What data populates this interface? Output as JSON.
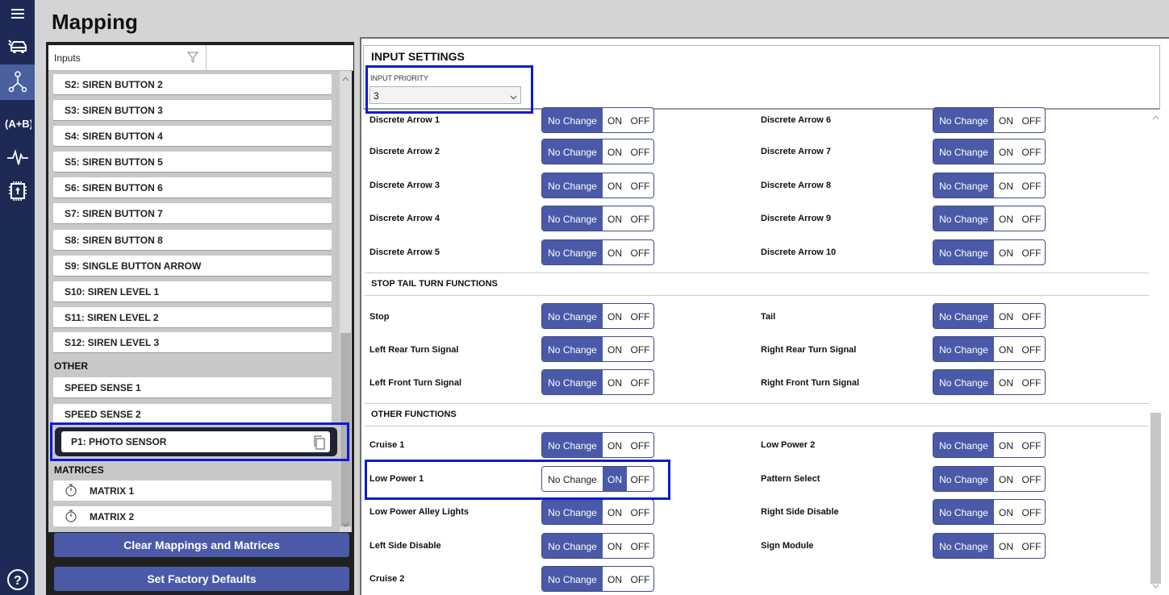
{
  "page": {
    "title": "Mapping"
  },
  "nav": {
    "icons": [
      "menu-icon",
      "vehicle-icon",
      "mapping-icon",
      "logic-icon",
      "pulse-icon",
      "chip-icon",
      "help-icon"
    ]
  },
  "inputs": {
    "header_label": "Inputs",
    "buttons": [
      "S2: SIREN BUTTON 2",
      "S3: SIREN BUTTON 3",
      "S4: SIREN BUTTON 4",
      "S5: SIREN BUTTON 5",
      "S6: SIREN BUTTON 6",
      "S7: SIREN BUTTON 7",
      "S8: SIREN BUTTON 8",
      "S9: SINGLE BUTTON ARROW",
      "S10: SIREN LEVEL 1",
      "S11: SIREN LEVEL 2",
      "S12: SIREN LEVEL 3"
    ],
    "other_header": "OTHER",
    "other": [
      "SPEED SENSE 1",
      "SPEED SENSE 2"
    ],
    "selected": "P1: PHOTO SENSOR",
    "matrices_header": "MATRICES",
    "matrices": [
      "MATRIX 1",
      "MATRIX 2"
    ],
    "clear_button": "Clear Mappings and Matrices",
    "factory_button": "Set Factory Defaults"
  },
  "settings": {
    "title": "INPUT SETTINGS",
    "priority_label": "INPUT PRIORITY",
    "priority_value": "3"
  },
  "toggle_labels": {
    "no_change": "No Change",
    "on": "ON",
    "off": "OFF"
  },
  "functions": {
    "discrete_left": [
      "Discrete Arrow 1",
      "Discrete Arrow 2",
      "Discrete Arrow 3",
      "Discrete Arrow 4",
      "Discrete Arrow 5"
    ],
    "discrete_right": [
      "Discrete Arrow 6",
      "Discrete Arrow 7",
      "Discrete Arrow 8",
      "Discrete Arrow 9",
      "Discrete Arrow 10"
    ],
    "stop_tail_title": "STOP TAIL TURN FUNCTIONS",
    "stop_left": [
      "Stop",
      "Left Rear Turn Signal",
      "Left Front Turn Signal"
    ],
    "stop_right": [
      "Tail",
      "Right Rear Turn Signal",
      "Right Front Turn Signal"
    ],
    "other_title": "OTHER FUNCTIONS",
    "other_left": [
      "Cruise 1",
      "Low Power 1",
      "Low Power Alley Lights",
      "Left Side Disable",
      "Cruise 2"
    ],
    "other_right": [
      "Low Power 2",
      "Pattern Select",
      "Right Side Disable",
      "Sign Module"
    ],
    "low_power_1_state": "ON"
  }
}
